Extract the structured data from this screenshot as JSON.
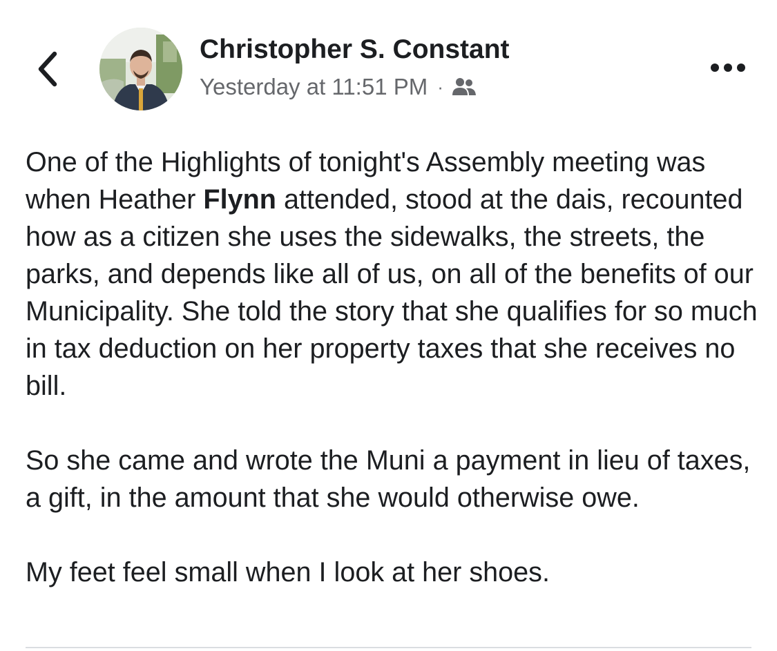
{
  "header": {
    "back_icon": "chevron-left-icon",
    "author_name": "Christopher S. Constant",
    "timestamp": "Yesterday at 11:51 PM",
    "separator": "·",
    "audience_icon": "friends-icon",
    "more_icon": "more-horizontal-icon"
  },
  "post": {
    "paragraph1": {
      "before_bold": "One of the Highlights of tonight's Assembly meeting was when Heather ",
      "bold": "Flynn",
      "after_bold": " attended, stood at the dais, recounted how as a citizen she uses the sidewalks, the streets, the parks, and depends like all of us, on all of the benefits of our Municipality.  She told the story that she qualifies for so much in tax deduction on her property taxes that she receives no bill."
    },
    "paragraph2": "So she came and wrote the Muni a payment in lieu of taxes, a gift, in the amount that she would otherwise owe.",
    "paragraph3": "My feet feel small when I look at her shoes."
  },
  "colors": {
    "text_primary": "#1c1e21",
    "text_secondary": "#65676b",
    "divider": "#dadde1"
  }
}
